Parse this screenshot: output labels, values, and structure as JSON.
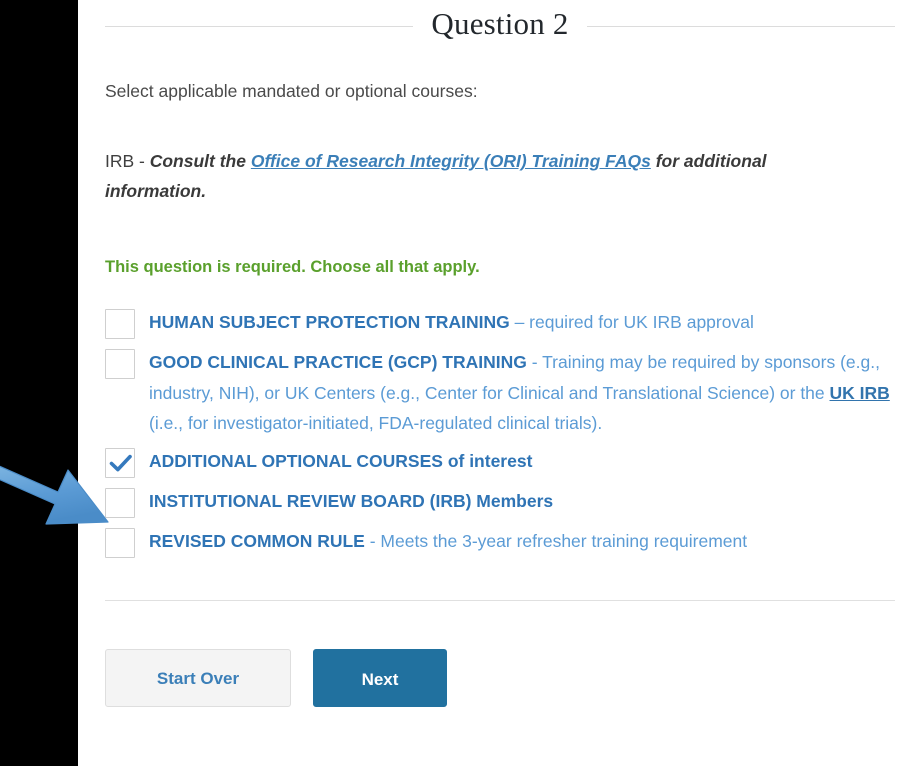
{
  "header": {
    "title": "Question 2"
  },
  "intro": {
    "prompt": "Select applicable mandated or optional courses:",
    "irb_lead": "IRB - ",
    "irb_em_before": "Consult the ",
    "irb_link": "Office of Research Integrity (ORI) Training FAQs",
    "irb_em_after": " for additional information.",
    "required_note": "This question is required. Choose all that apply."
  },
  "options": [
    {
      "id": "human-subject-protection-training",
      "checked": false,
      "strong": "HUMAN SUBJECT PROTECTION TRAINING",
      "rest": " – required for UK IRB approval",
      "rest_tail": "",
      "link": ""
    },
    {
      "id": "good-clinical-practice-gcp-training",
      "checked": false,
      "strong": "GOOD CLINICAL PRACTICE (GCP) TRAINING",
      "rest": " - Training may be required by sponsors (e.g., industry, NIH), or UK Centers (e.g., Center for Clinical and Translational Science) or the ",
      "link": "UK IRB",
      "rest_tail": " (i.e., for investigator-initiated, FDA-regulated clinical trials)."
    },
    {
      "id": "additional-optional-courses",
      "checked": true,
      "strong": "ADDITIONAL OPTIONAL COURSES of interest",
      "rest": "",
      "rest_tail": "",
      "link": ""
    },
    {
      "id": "institutional-review-board-irb-members",
      "checked": false,
      "strong": "INSTITUTIONAL REVIEW BOARD (IRB) Members",
      "rest": "",
      "rest_tail": "",
      "link": ""
    },
    {
      "id": "revised-common-rule",
      "checked": false,
      "strong": "REVISED COMMON RULE",
      "rest": " - Meets the 3-year refresher training requirement",
      "rest_tail": "",
      "link": ""
    }
  ],
  "footer": {
    "start_over_label": "Start Over",
    "next_label": "Next"
  },
  "colors": {
    "link_blue": "#3b7fb8",
    "option_strong_blue": "#2f74b5",
    "option_text_blue": "#5b9bd5",
    "required_green": "#5aa02c",
    "primary_button": "#21719f",
    "arrow_blue": "#5b9bd5",
    "gutter_black": "#000000"
  },
  "annotation": {
    "arrow_icon": "arrow-pointing-down-right",
    "points_at": "additional-optional-courses"
  }
}
